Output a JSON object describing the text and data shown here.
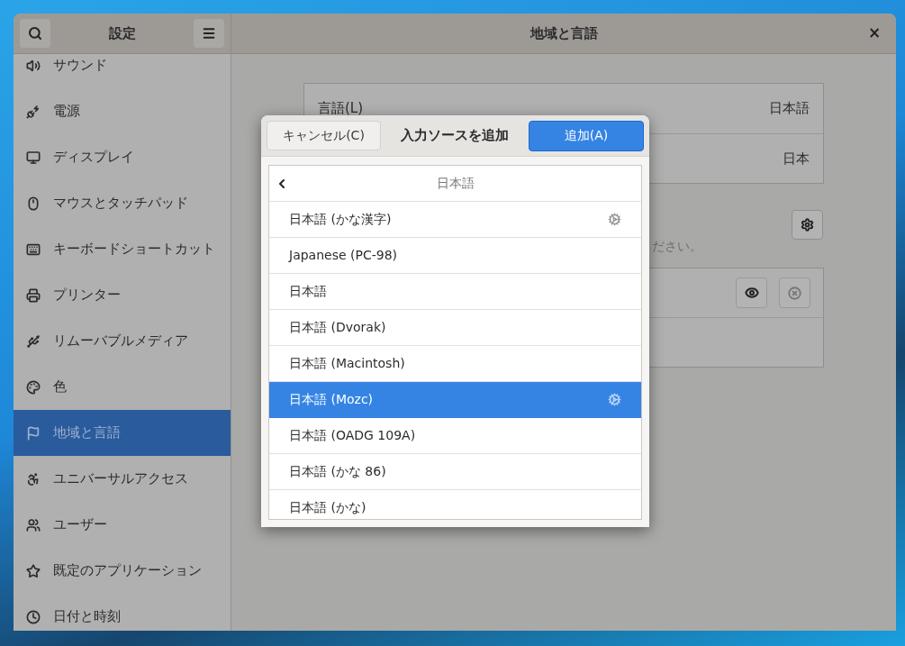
{
  "window": {
    "title": "地域と言語",
    "close": "×"
  },
  "sidebar": {
    "title": "設定",
    "items": [
      {
        "label": "サウンド",
        "selected": false
      },
      {
        "label": "電源",
        "selected": false
      },
      {
        "label": "ディスプレイ",
        "selected": false
      },
      {
        "label": "マウスとタッチパッド",
        "selected": false
      },
      {
        "label": "キーボードショートカット",
        "selected": false
      },
      {
        "label": "プリンター",
        "selected": false
      },
      {
        "label": "リムーバブルメディア",
        "selected": false
      },
      {
        "label": "色",
        "selected": false
      },
      {
        "label": "地域と言語",
        "selected": true
      },
      {
        "label": "ユニバーサルアクセス",
        "selected": false
      },
      {
        "label": "ユーザー",
        "selected": false
      },
      {
        "label": "既定のアプリケーション",
        "selected": false
      },
      {
        "label": "日付と時刻",
        "selected": false
      }
    ]
  },
  "main": {
    "settings_rows": [
      {
        "label": "言語(L)",
        "value": "日本語"
      },
      {
        "value": "日本"
      }
    ],
    "hint": "ださい。"
  },
  "dialog": {
    "cancel": "キャンセル(C)",
    "title": "入力ソースを追加",
    "add": "追加(A)",
    "list_header": "日本語",
    "items": [
      {
        "label": "日本語 (かな漢字)",
        "selected": false,
        "settings": true
      },
      {
        "label": "Japanese (PC-98)",
        "selected": false,
        "settings": false
      },
      {
        "label": "日本語",
        "selected": false,
        "settings": false
      },
      {
        "label": "日本語 (Dvorak)",
        "selected": false,
        "settings": false
      },
      {
        "label": "日本語 (Macintosh)",
        "selected": false,
        "settings": false
      },
      {
        "label": "日本語 (Mozc)",
        "selected": true,
        "settings": true
      },
      {
        "label": "日本語 (OADG 109A)",
        "selected": false,
        "settings": false
      },
      {
        "label": "日本語 (かな 86)",
        "selected": false,
        "settings": false
      },
      {
        "label": "日本語 (かな)",
        "selected": false,
        "settings": false
      }
    ]
  }
}
